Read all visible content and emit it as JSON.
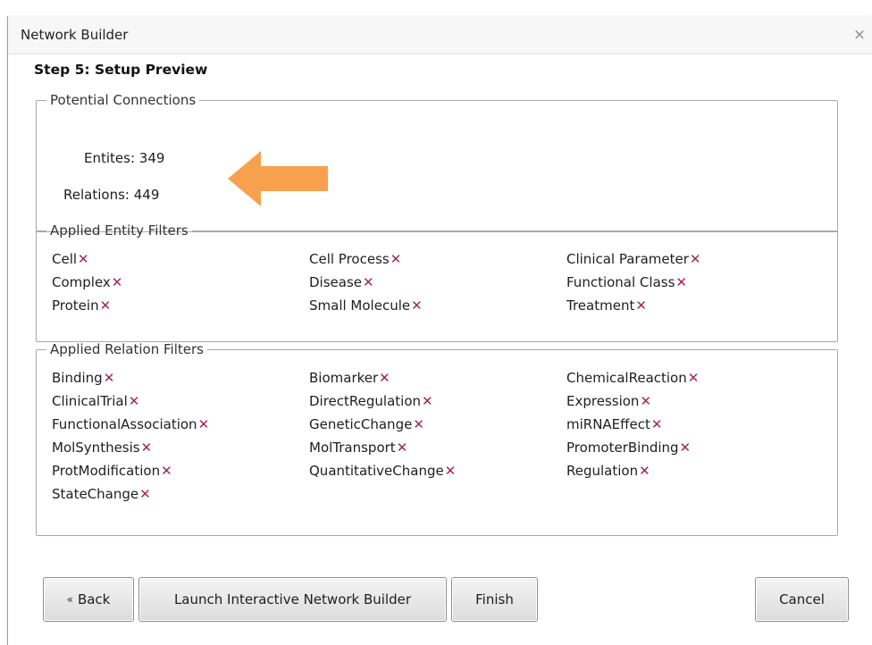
{
  "window": {
    "title": "Network Builder",
    "close_glyph": "×"
  },
  "step_title": "Step 5: Setup Preview",
  "potential_connections": {
    "legend": "Potential Connections",
    "entities_label": "Entites:",
    "entities_value": "349",
    "relations_label": "Relations:",
    "relations_value": "449"
  },
  "entity_filters": {
    "legend": "Applied Entity Filters",
    "items": [
      "Cell",
      "Cell Process",
      "Clinical Parameter",
      "Complex",
      "Disease",
      "Functional Class",
      "Protein",
      "Small Molecule",
      "Treatment"
    ]
  },
  "relation_filters": {
    "legend": "Applied Relation Filters",
    "items": [
      "Binding",
      "Biomarker",
      "ChemicalReaction",
      "ClinicalTrial",
      "DirectRegulation",
      "Expression",
      "FunctionalAssociation",
      "GeneticChange",
      "miRNAEffect",
      "MolSynthesis",
      "MolTransport",
      "PromoterBinding",
      "ProtModification",
      "QuantitativeChange",
      "Regulation",
      "StateChange"
    ]
  },
  "remove_glyph": "✕",
  "buttons": {
    "back_prefix": "«",
    "back": "Back",
    "launch": "Launch Interactive Network Builder",
    "finish": "Finish",
    "cancel": "Cancel"
  },
  "colors": {
    "remove_x": "#a4264b",
    "arrow": "#f7a14f"
  },
  "icons": {
    "remove": "remove-x-icon",
    "close": "close-icon",
    "annotation": "arrow-left-icon"
  }
}
